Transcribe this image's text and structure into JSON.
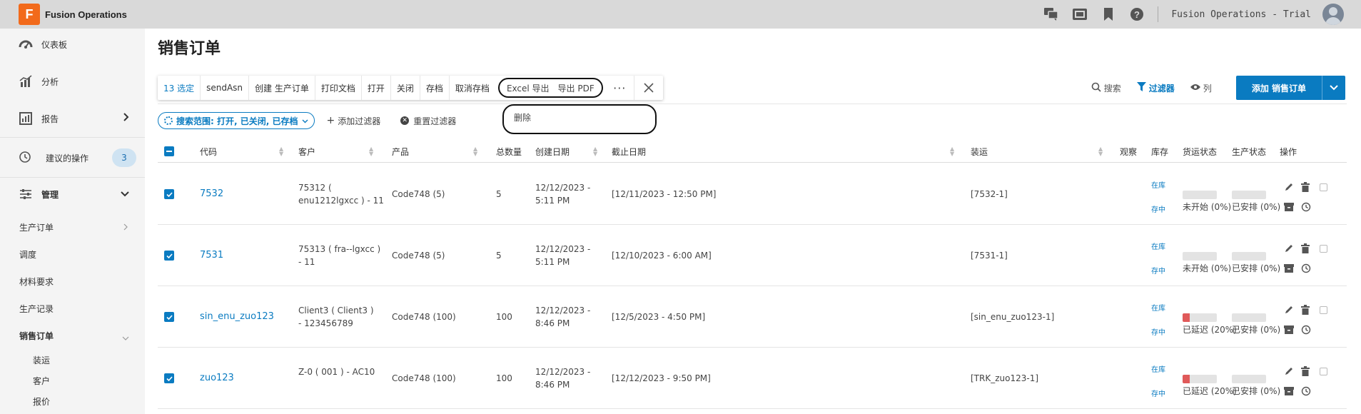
{
  "app": {
    "name": "Fusion Operations",
    "logo_letter": "F",
    "trial_label": "Fusion Operations - Trial"
  },
  "topbar": {
    "icons": [
      "chat-icon",
      "tv-icon",
      "bookmark-icon",
      "help-icon"
    ]
  },
  "sidebar": {
    "items": [
      {
        "label": "仪表板",
        "icon": "dashboard-icon"
      },
      {
        "label": "分析",
        "icon": "analytics-icon"
      },
      {
        "label": "报告",
        "icon": "report-icon"
      },
      {
        "label": "建议的操作",
        "icon": "history-icon",
        "badge": "3"
      },
      {
        "label": "管理",
        "icon": "sliders-icon"
      }
    ],
    "sub_items": [
      "生产订单",
      "调度",
      "材料要求",
      "生产记录",
      "销售订单"
    ],
    "sales_children": [
      "装运",
      "客户",
      "报价"
    ]
  },
  "page": {
    "title": "销售订单"
  },
  "toolbar": {
    "selected": "13 选定",
    "buttons": [
      "sendAsn",
      "创建 生产订单",
      "打印文档",
      "打开",
      "关闭",
      "存档",
      "取消存档"
    ],
    "export_excel": "Excel 导出",
    "export_pdf": "导出 PDF",
    "more": "···"
  },
  "dropdown": {
    "delete": "删除"
  },
  "right_actions": {
    "search": "搜索",
    "filter": "过滤器",
    "columns": "列",
    "add": "添加 销售订单"
  },
  "filters": {
    "scope": "搜索范围: 打开, 已关闭, 已存档",
    "add_filter": "添加过滤器",
    "reset_filter": "重置过滤器"
  },
  "table": {
    "columns": [
      "代码",
      "客户",
      "产品",
      "总数量",
      "创建日期",
      "截止日期",
      "装运",
      "观察",
      "库存",
      "货运状态",
      "生产状态",
      "操作"
    ],
    "rows": [
      {
        "code": "7532",
        "customer_1": "75312 (",
        "customer_2": "enu1212lgxcc ) - 11",
        "product": "Code748 (5)",
        "qty": "5",
        "created_1": "12/12/2023 -",
        "created_2": "5:11 PM",
        "due": "[12/11/2023 - 12:50 PM]",
        "shipment": "[7532-1]",
        "stock_1": "在库",
        "stock_2": "存中",
        "ship_status": "未开始 (0%)",
        "ship_pct": 0,
        "prod_status": "已安排 (0%)",
        "prod_pct": 0
      },
      {
        "code": "7531",
        "customer_1": "75313 ( fra--lgxcc )",
        "customer_2": "- 11",
        "product": "Code748 (5)",
        "qty": "5",
        "created_1": "12/12/2023 -",
        "created_2": "5:11 PM",
        "due": "[12/10/2023 - 6:00 AM]",
        "shipment": "[7531-1]",
        "stock_1": "在库",
        "stock_2": "存中",
        "ship_status": "未开始 (0%)",
        "ship_pct": 0,
        "prod_status": "已安排 (0%)",
        "prod_pct": 0
      },
      {
        "code": "sin_enu_zuo123",
        "customer_1": "Client3 ( Client3 )",
        "customer_2": "- 123456789",
        "product": "Code748 (100)",
        "qty": "100",
        "created_1": "12/12/2023 -",
        "created_2": "8:46 PM",
        "due": "[12/5/2023 - 4:50 PM]",
        "shipment": "[sin_enu_zuo123-1]",
        "stock_1": "在库",
        "stock_2": "存中",
        "ship_status": "已延迟 (20%)",
        "ship_pct": 20,
        "prod_status": "已安排 (0%)",
        "prod_pct": 0
      },
      {
        "code": "zuo123",
        "customer_1": "Z-0 ( 001 ) - AC10",
        "customer_2": "",
        "product": "Code748 (100)",
        "qty": "100",
        "created_1": "12/12/2023 -",
        "created_2": "8:46 PM",
        "due": "[12/12/2023 - 9:50 PM]",
        "shipment": "[TRK_zuo123-1]",
        "stock_1": "在库",
        "stock_2": "存中",
        "ship_status": "已延迟 (20%)",
        "ship_pct": 20,
        "prod_status": "已安排 (0%)",
        "prod_pct": 0
      }
    ]
  }
}
